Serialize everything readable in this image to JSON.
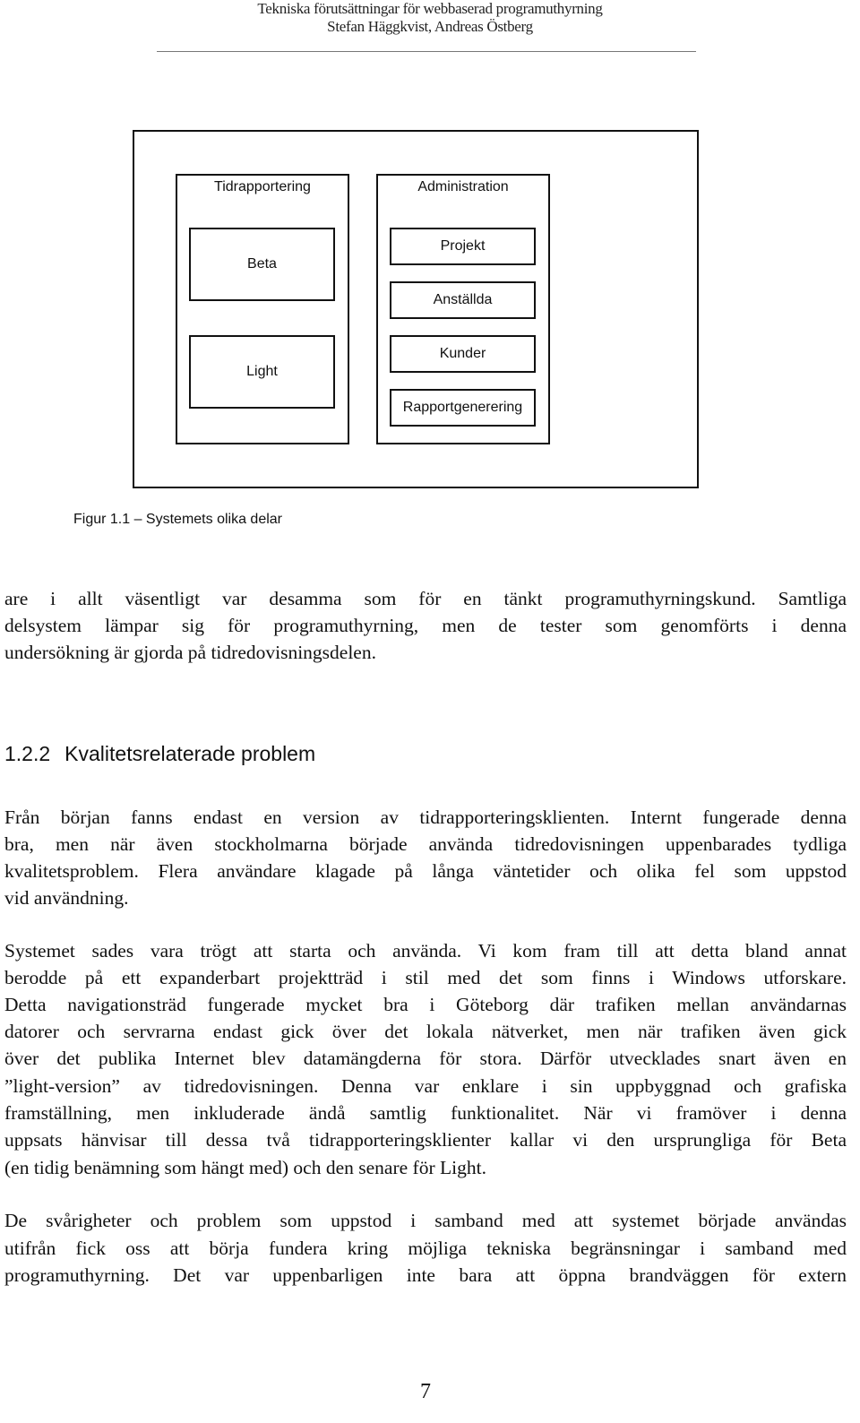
{
  "header": {
    "title": "Tekniska förutsättningar för webbaserad programuthyrning",
    "authors": "Stefan Häggkvist, Andreas Östberg"
  },
  "figure": {
    "groups": [
      {
        "title": "Tidrapportering",
        "items": [
          "Beta",
          "Light"
        ]
      },
      {
        "title": "Administration",
        "items": [
          "Projekt",
          "Anställda",
          "Kunder",
          "Rapportgenerering"
        ]
      }
    ],
    "caption": "Figur 1.1 – Systemets olika delar"
  },
  "paragraphs": [
    {
      "lines": [
        "are i allt väsentligt var desamma som för en tänkt programuthyrningskund. Samtliga",
        "delsystem lämpar sig för programuthyrning, men de tester som genomförts i denna",
        "undersökning är gjorda på tidredovisningsdelen."
      ]
    }
  ],
  "section": {
    "number": "1.2.2",
    "title": "Kvalitetsrelaterade problem"
  },
  "section_paragraphs": [
    {
      "lines": [
        "Från början fanns endast en version av tidrapporteringsklienten. Internt fungerade denna",
        "bra, men när även stockholmarna började använda tidredovisningen uppenbarades tydliga",
        "kvalitetsproblem. Flera användare klagade på långa väntetider och olika fel som uppstod",
        "vid användning."
      ]
    },
    {
      "lines": [
        "Systemet sades vara trögt att starta och använda. Vi kom fram till att detta bland annat",
        "berodde på ett expanderbart projektträd i stil med det som finns i Windows utforskare.",
        "Detta navigationsträd fungerade mycket bra i Göteborg där trafiken mellan användarnas",
        "datorer och servrarna endast gick över det lokala nätverket, men när trafiken även gick",
        "över det publika Internet blev datamängderna för stora. Därför utvecklades snart även en",
        "”light-version” av tidredovisningen. Denna var enklare i sin uppbyggnad och grafiska",
        "framställning, men inkluderade ändå samtlig funktionalitet. När vi framöver i denna",
        "uppsats hänvisar till dessa två tidrapporteringsklienter kallar vi den ursprungliga för Beta",
        "(en tidig benämning som hängt med) och den senare för Light."
      ]
    },
    {
      "lines": [
        "De svårigheter och problem som uppstod i samband med att systemet började användas",
        "utifrån fick oss att börja fundera kring möjliga tekniska begränsningar i samband med",
        "programuthyrning. Det var uppenbarligen inte bara att öppna brandväggen för extern"
      ]
    }
  ],
  "page_number": "7"
}
